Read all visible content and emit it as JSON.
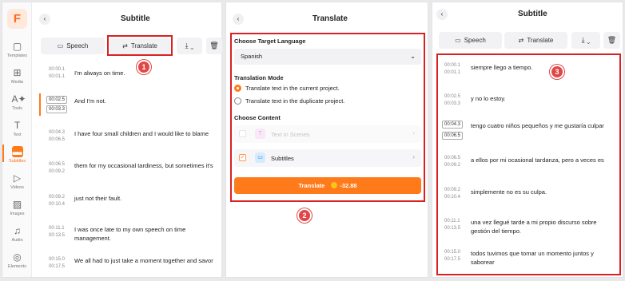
{
  "panel1": {
    "title": "Subtitle",
    "logo": "F",
    "sidebar": [
      {
        "label": "Templates",
        "icon": "template-icon"
      },
      {
        "label": "Media",
        "icon": "media-icon"
      },
      {
        "label": "Tools",
        "icon": "ai-tools-icon"
      },
      {
        "label": "Text",
        "icon": "text-icon"
      },
      {
        "label": "Subtitles",
        "icon": "subtitles-icon"
      },
      {
        "label": "Videos",
        "icon": "videos-icon"
      },
      {
        "label": "Images",
        "icon": "images-icon"
      },
      {
        "label": "Audio",
        "icon": "audio-icon"
      },
      {
        "label": "Elements",
        "icon": "elements-icon"
      }
    ],
    "tabs": {
      "speech": "Speech",
      "translate": "Translate"
    },
    "callout": "1",
    "rows": [
      {
        "start": "00:00.1",
        "end": "00:01.1",
        "text": "I'm always on time."
      },
      {
        "start": "00:02.5",
        "end": "00:03.3",
        "text": "And I'm not."
      },
      {
        "start": "00:04.3",
        "end": "00:06.5",
        "text": "I have four small children and I would like to blame"
      },
      {
        "start": "00:06.5",
        "end": "00:09.2",
        "text": "them for my occasional tardiness, but sometimes it's"
      },
      {
        "start": "00:09.2",
        "end": "00:10.4",
        "text": "just not their fault."
      },
      {
        "start": "00:11.1",
        "end": "00:13.5",
        "text": "I was once late to my own speech on time management."
      },
      {
        "start": "00:15.0",
        "end": "00:17.5",
        "text": "We all had to just take a moment together and savor"
      }
    ]
  },
  "panel2": {
    "title": "Translate",
    "target_language_label": "Choose Target Language",
    "target_language_value": "Spanish",
    "mode_label": "Translation Mode",
    "mode_options": [
      "Translate text in the current project.",
      "Translate text in the duplicate project."
    ],
    "content_label": "Choose Content",
    "content_options": [
      "Text in Scenes",
      "Subtitles"
    ],
    "translate_button": "Translate",
    "cost": "-32.88",
    "callout": "2"
  },
  "panel3": {
    "title": "Subtitle",
    "tabs": {
      "speech": "Speech",
      "translate": "Translate"
    },
    "callout": "3",
    "rows": [
      {
        "start": "00:00.1",
        "end": "00:01.1",
        "text": "siempre llego a tiempo."
      },
      {
        "start": "00:02.5",
        "end": "00:03.3",
        "text": "y no lo estoy."
      },
      {
        "start": "00:04.3",
        "end": "00:06.5",
        "text": "tengo cuatro niños pequeños y me gustaría culpar"
      },
      {
        "start": "00:06.5",
        "end": "00:09.2",
        "text": "a ellos por mi ocasional tardanza, pero a veces es"
      },
      {
        "start": "00:09.2",
        "end": "00:10.4",
        "text": "simplemente no es su culpa."
      },
      {
        "start": "00:11.1",
        "end": "00:13.5",
        "text": "una vez llegué tarde a mi propio discurso sobre gestión del tiempo."
      },
      {
        "start": "00:15.0",
        "end": "00:17.5",
        "text": "todos tuvimos que tomar un momento juntos y saborear"
      }
    ]
  }
}
